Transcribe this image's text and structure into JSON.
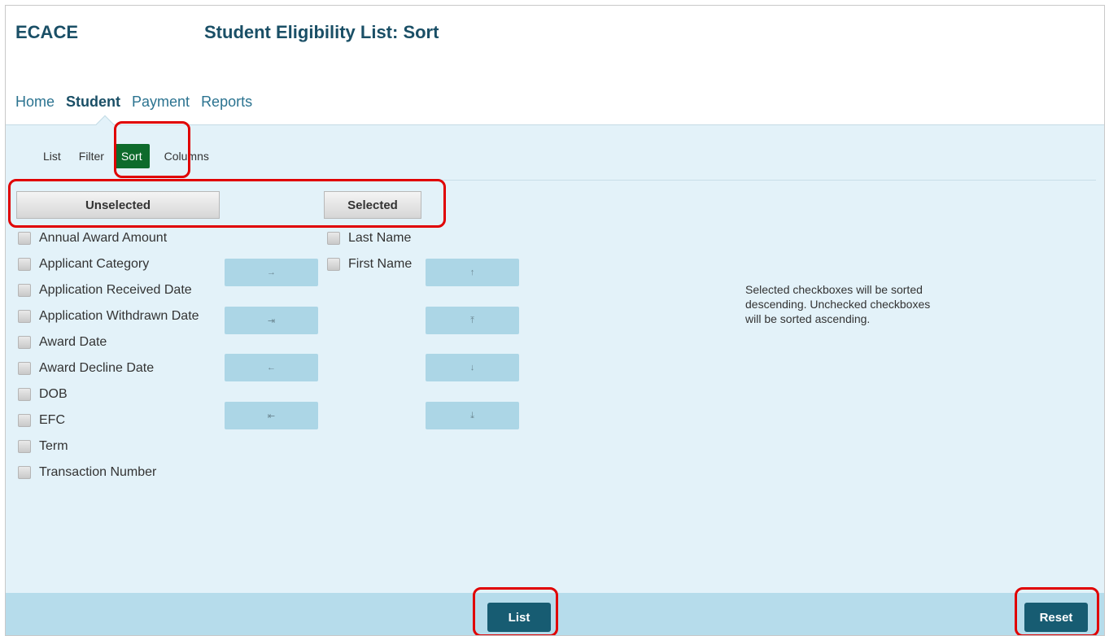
{
  "header": {
    "brand": "ECACE",
    "title": "Student Eligibility List: Sort"
  },
  "main_nav": [
    {
      "label": "Home",
      "active": false
    },
    {
      "label": "Student",
      "active": true
    },
    {
      "label": "Payment",
      "active": false
    },
    {
      "label": "Reports",
      "active": false
    }
  ],
  "sub_nav": {
    "list": "List",
    "filter": "Filter",
    "sort": "Sort",
    "columns": "Columns",
    "active": "Sort"
  },
  "panels": {
    "unselected_label": "Unselected",
    "selected_label": "Selected",
    "unselected_items": [
      "Annual Award Amount",
      "Applicant Category",
      "Application Received Date",
      "Application Withdrawn Date",
      "Award Date",
      "Award Decline Date",
      "DOB",
      "EFC",
      "Term",
      "Transaction Number"
    ],
    "selected_items": [
      "Last Name",
      "First Name"
    ]
  },
  "move_buttons": {
    "move_right": "→",
    "move_all_right": "⇥",
    "move_left": "←",
    "move_all_left": "⇤",
    "move_up": "↑",
    "move_top": "⤒",
    "move_down": "↓",
    "move_bottom": "⤓"
  },
  "help_text": "Selected checkboxes will be sorted descending. Unchecked checkboxes will be sorted ascending.",
  "footer": {
    "list_label": "List",
    "reset_label": "Reset"
  },
  "colors": {
    "accent": "#175c72",
    "active_sub": "#0e6b2c",
    "panel_bg": "#e3f2f9",
    "highlight": "#e00000"
  }
}
